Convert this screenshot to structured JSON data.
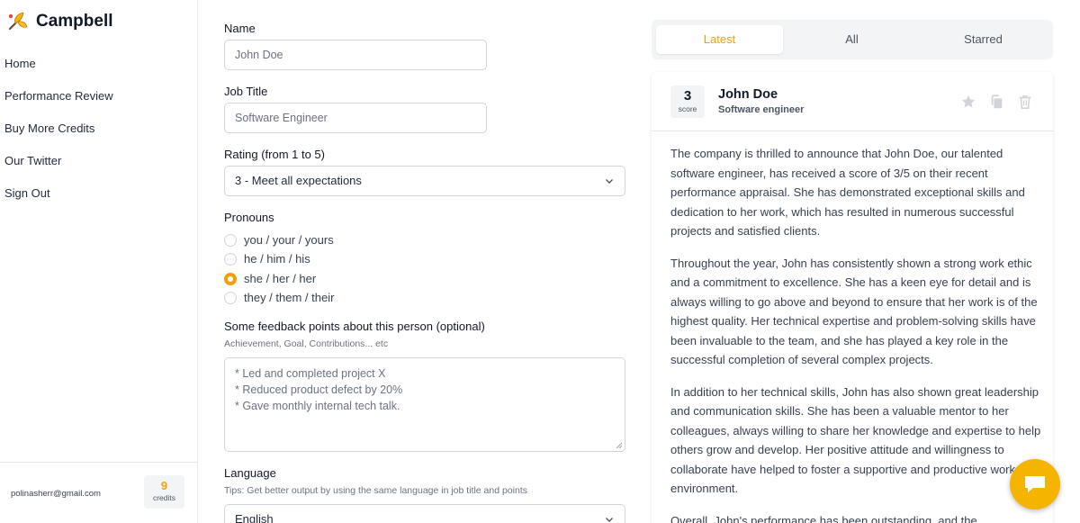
{
  "app": {
    "name": "Campbell"
  },
  "sidebar": {
    "items": [
      {
        "label": "Home"
      },
      {
        "label": "Performance Review"
      },
      {
        "label": "Buy More Credits"
      },
      {
        "label": "Our Twitter"
      },
      {
        "label": "Sign Out"
      }
    ],
    "footer": {
      "email": "polinasherr@gmail.com",
      "credits_count": "9",
      "credits_label": "credits"
    }
  },
  "form": {
    "name": {
      "label": "Name",
      "value": "John Doe"
    },
    "job_title": {
      "label": "Job Title",
      "value": "Software Engineer"
    },
    "rating": {
      "label": "Rating (from 1 to 5)",
      "value": "3 - Meet all expectations"
    },
    "pronouns": {
      "label": "Pronouns",
      "options": [
        "you / your / yours",
        "he / him / his",
        "she / her / her",
        "they / them / their"
      ],
      "selected_index": 2
    },
    "feedback": {
      "label": "Some feedback points about this person (optional)",
      "hint": "Achievement, Goal, Contributions... etc",
      "lines": [
        "* Led and completed project X",
        "* Reduced product defect by 20%",
        "* Gave monthly internal tech talk."
      ]
    },
    "language": {
      "label": "Language",
      "hint": "Tips: Get better output by using the same language in job title and points",
      "value": "English"
    }
  },
  "results": {
    "tabs": [
      {
        "label": "Latest",
        "active": true
      },
      {
        "label": "All"
      },
      {
        "label": "Starred"
      }
    ],
    "card": {
      "score": "3",
      "score_label": "score",
      "name": "John Doe",
      "title": "Software engineer",
      "paragraphs": [
        "The company is thrilled to announce that John Doe, our talented software engineer, has received a score of 3/5 on their recent performance appraisal. She has demonstrated exceptional skills and dedication to her work, which has resulted in numerous successful projects and satisfied clients.",
        "Throughout the year, John has consistently shown a strong work ethic and a commitment to excellence. She has a keen eye for detail and is always willing to go above and beyond to ensure that her work is of the highest quality. Her technical expertise and problem-solving skills have been invaluable to the team, and she has played a key role in the successful completion of several complex projects.",
        "In addition to her technical skills, John has also shown great leadership and communication skills. She has been a valuable mentor to her colleagues, always willing to share her knowledge and expertise to help others grow and develop. Her positive attitude and willingness to collaborate have helped to foster a supportive and productive work environment.",
        "Overall, John's performance has been outstanding, and the"
      ]
    }
  },
  "colors": {
    "accent": "#f59e0b",
    "chat": "#f5b400",
    "border": "#d1d5db",
    "muted_bg": "#f3f4f6"
  },
  "icons": {
    "logo": "campbell-logo-icon",
    "chevron": "chevron-down-icon",
    "star": "star-icon",
    "copy": "copy-icon",
    "trash": "trash-icon",
    "chat": "chat-icon"
  }
}
